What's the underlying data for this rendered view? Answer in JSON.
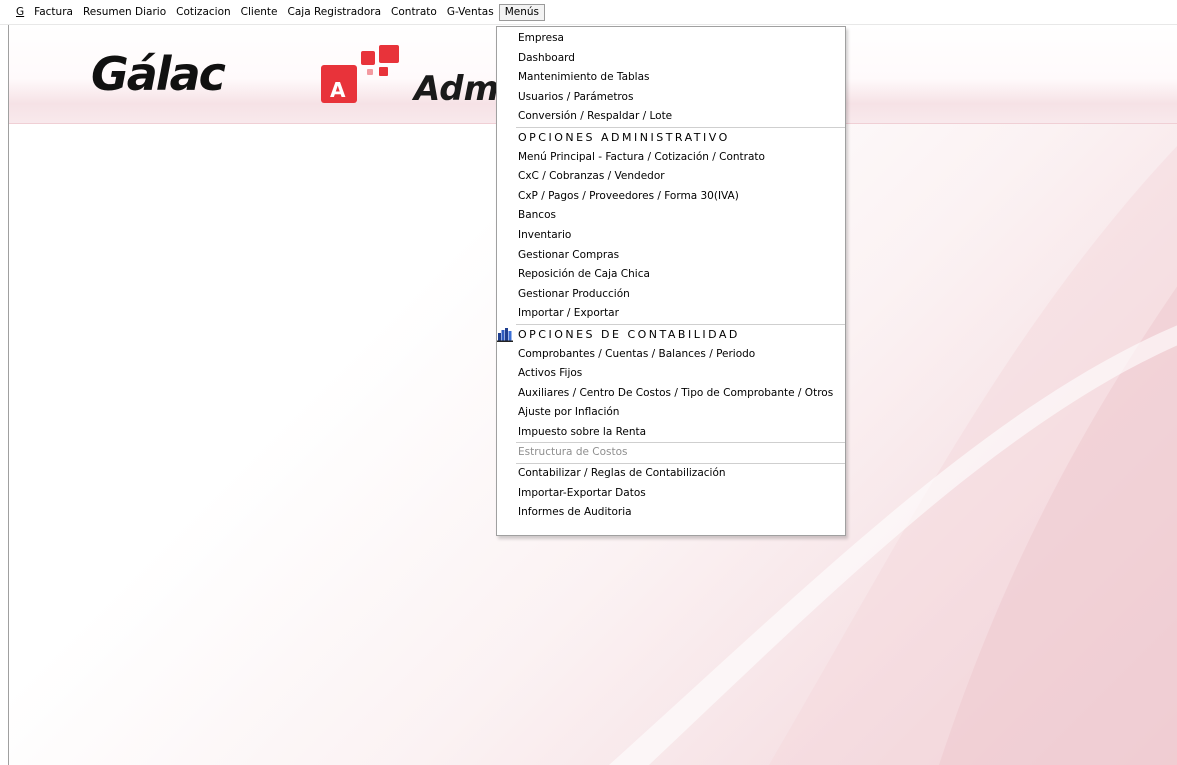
{
  "menubar": {
    "items": [
      {
        "label": "G"
      },
      {
        "label": "Factura"
      },
      {
        "label": "Resumen Diario"
      },
      {
        "label": "Cotizacion"
      },
      {
        "label": "Cliente"
      },
      {
        "label": "Caja Registradora"
      },
      {
        "label": "Contrato"
      },
      {
        "label": "G-Ventas"
      },
      {
        "label": "Menús"
      }
    ]
  },
  "banner": {
    "logo_text": "Gálac",
    "app_icon_letter": "A",
    "app_name_partial": "Adm"
  },
  "dropdown": {
    "group1": [
      "Empresa",
      "Dashboard",
      "Mantenimiento de Tablas",
      "Usuarios / Parámetros",
      "Conversión / Respaldar / Lote"
    ],
    "header_admin": "OPCIONES ADMINISTRATIVO",
    "group2": [
      "Menú Principal - Factura / Cotización / Contrato",
      "CxC / Cobranzas / Vendedor",
      "CxP / Pagos / Proveedores / Forma 30(IVA)",
      "Bancos",
      "Inventario",
      "Gestionar Compras",
      "Reposición de Caja Chica",
      "Gestionar Producción",
      "Importar / Exportar"
    ],
    "header_conta": "OPCIONES DE CONTABILIDAD",
    "group3": [
      "Comprobantes / Cuentas / Balances / Periodo",
      "Activos Fijos",
      "Auxiliares / Centro De Costos / Tipo de Comprobante / Otros",
      "Ajuste por Inflación",
      "Impuesto sobre la Renta"
    ],
    "disabled_item": "Estructura de Costos",
    "group4": [
      "Contabilizar / Reglas de Contabilización",
      "Importar-Exportar Datos",
      "Informes de Auditoria"
    ]
  },
  "colors": {
    "accent": "#e8333a",
    "brand_text": "#111111"
  }
}
